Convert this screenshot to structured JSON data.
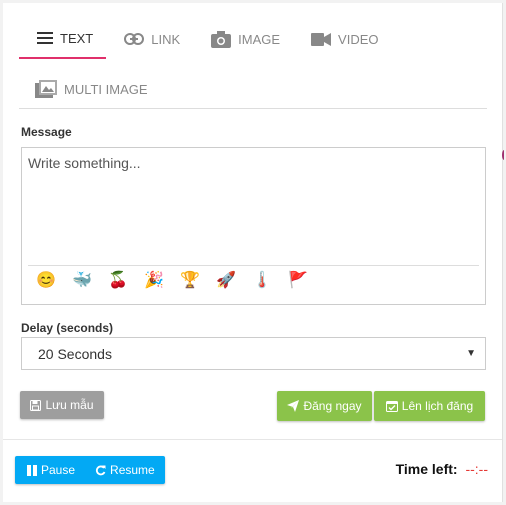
{
  "tabs": [
    {
      "label": "TEXT",
      "icon": "text-lines-icon"
    },
    {
      "label": "LINK",
      "icon": "link-icon"
    },
    {
      "label": "IMAGE",
      "icon": "camera-icon"
    },
    {
      "label": "VIDEO",
      "icon": "video-camera-icon"
    },
    {
      "label": "MULTI IMAGE",
      "icon": "images-icon"
    }
  ],
  "message": {
    "label": "Message",
    "placeholder": "Write something...",
    "emojis": [
      "😊",
      "🐳",
      "🍒",
      "🎉",
      "🏆",
      "🚀",
      "🌡️",
      "🚩"
    ]
  },
  "delay": {
    "label": "Delay (seconds)",
    "selected": "20 Seconds"
  },
  "buttons": {
    "save": "Lưu mẫu",
    "post_now": "Đăng ngay",
    "schedule": "Lên lịch đăng",
    "pause": "Pause",
    "resume": "Resume"
  },
  "timer": {
    "label": "Time left:",
    "value": "--:--"
  },
  "colors": {
    "active_tab_underline": "#e0306b",
    "green_button": "#8bc34a",
    "blue_button": "#03a9f4",
    "grey_button": "#9e9e9e",
    "timer_value": "#e53935"
  }
}
